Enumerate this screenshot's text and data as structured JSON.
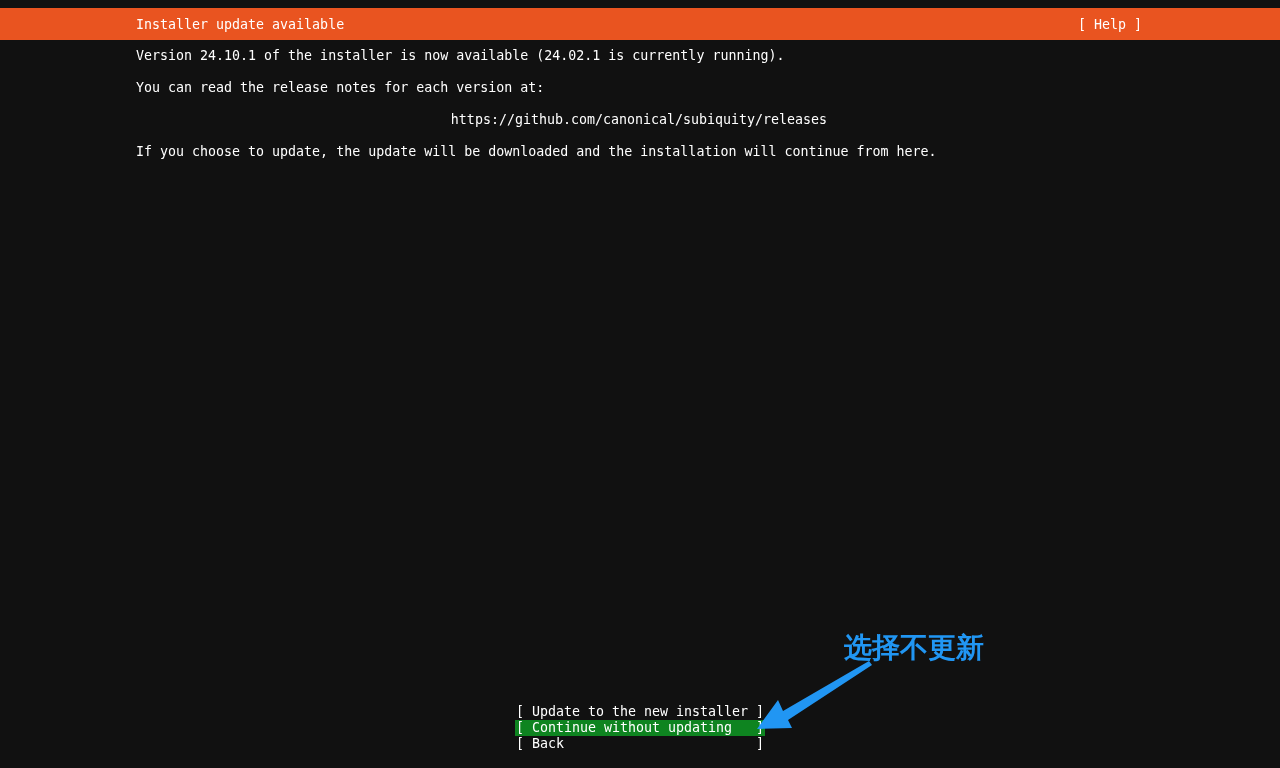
{
  "header": {
    "title": "Installer update available",
    "help": "[ Help ]"
  },
  "body": {
    "lines": [
      {
        "kind": "text",
        "text": "Version 24.10.1 of the installer is now available (24.02.1 is currently running)."
      },
      {
        "kind": "text",
        "text": "You can read the release notes for each version at:"
      },
      {
        "kind": "link",
        "text": "https://github.com/canonical/subiquity/releases"
      },
      {
        "kind": "text",
        "text": "If you choose to update, the update will be downloaded and the installation will continue from here."
      }
    ]
  },
  "buttons": [
    {
      "label": "[ Update to the new installer ]",
      "selected": false
    },
    {
      "label": "[ Continue without updating   ]",
      "selected": true
    },
    {
      "label": "[ Back                        ]",
      "selected": false
    }
  ],
  "annotation": {
    "text": "选择不更新"
  }
}
